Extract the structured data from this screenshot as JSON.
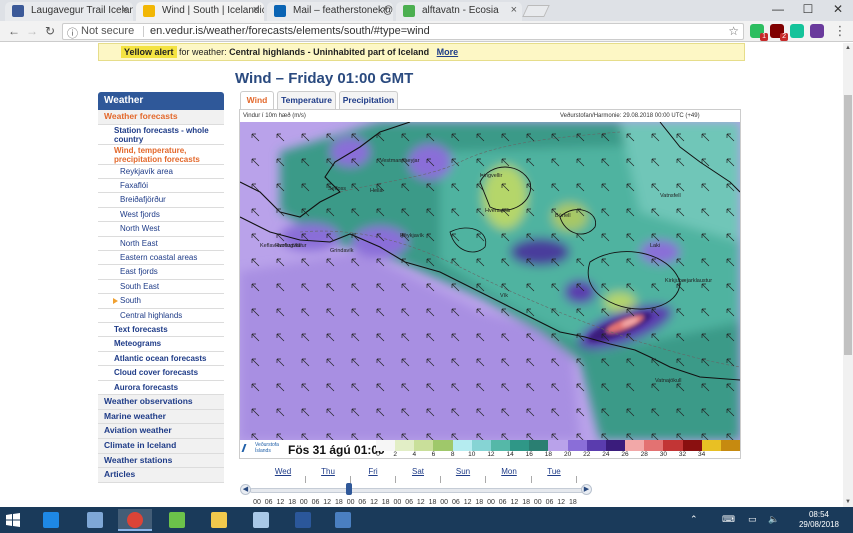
{
  "browser": {
    "tabs": [
      {
        "title": "Laugavegur Trail Iceland",
        "favicon": "facebook-icon",
        "color": "#3b5998",
        "active": false
      },
      {
        "title": "Wind | South | Icelandic M",
        "favicon": "sun-icon",
        "color": "#f2b705",
        "active": true
      },
      {
        "title": "Mail – featherstonek@liv",
        "favicon": "outlook-icon",
        "color": "#0a64b4",
        "active": false
      },
      {
        "title": "alftavatn - Ecosia",
        "favicon": "ecosia-icon",
        "color": "#4caf50",
        "active": false
      }
    ],
    "security": "Not secure",
    "url": "en.vedur.is/weather/forecasts/elements/south/#type=wind",
    "extensions": [
      {
        "name": "evernote-icon",
        "color": "#2dbe60",
        "badge": "1"
      },
      {
        "name": "ublock-icon",
        "color": "#800000",
        "badge": "2"
      },
      {
        "name": "grammarly-icon",
        "color": "#15c39a",
        "badge": ""
      },
      {
        "name": "ghost-icon",
        "color": "#6a3a9c",
        "badge": ""
      }
    ]
  },
  "alert": {
    "tag": "Yellow alert",
    "text": "for weather:",
    "region": "Central highlands - Uninhabited part of Iceland",
    "more": "More"
  },
  "page": {
    "title": "Wind – Friday 01:00 GMT",
    "tabs": [
      "Wind",
      "Temperature",
      "Precipitation"
    ],
    "active_tab": "Wind"
  },
  "sidebar": {
    "heading": "Weather",
    "items": [
      {
        "label": "Weather forecasts",
        "level": 1,
        "active": true
      },
      {
        "label": "Station forecasts - whole country",
        "level": 2,
        "tall": true
      },
      {
        "label": "Wind, temperature, precipitation forecasts",
        "level": 2,
        "active": true,
        "tall": true
      },
      {
        "label": "Reykjavík area",
        "level": 3
      },
      {
        "label": "Faxaflói",
        "level": 3
      },
      {
        "label": "Breiðafjörður",
        "level": 3
      },
      {
        "label": "West fjords",
        "level": 3
      },
      {
        "label": "North West",
        "level": 3
      },
      {
        "label": "North East",
        "level": 3
      },
      {
        "label": "Eastern coastal areas",
        "level": 3
      },
      {
        "label": "East fjords",
        "level": 3
      },
      {
        "label": "South East",
        "level": 3
      },
      {
        "label": "South",
        "level": 3,
        "current": true
      },
      {
        "label": "Central highlands",
        "level": 3
      },
      {
        "label": "Text forecasts",
        "level": 2
      },
      {
        "label": "Meteograms",
        "level": 2
      },
      {
        "label": "Atlantic ocean forecasts",
        "level": 2
      },
      {
        "label": "Cloud cover forecasts",
        "level": 2
      },
      {
        "label": "Aurora forecasts",
        "level": 2
      },
      {
        "label": "Weather observations",
        "level": 1
      },
      {
        "label": "Marine weather",
        "level": 1
      },
      {
        "label": "Aviation weather",
        "level": 1
      },
      {
        "label": "Climate in Iceland",
        "level": 1
      },
      {
        "label": "Weather stations",
        "level": 1
      },
      {
        "label": "Articles",
        "level": 1
      }
    ]
  },
  "map": {
    "header_left": "Vindur í 10m hæð (m/s)",
    "header_right": "Veðurstofan/Harmonie: 29.08.2018 00:00 UTC (+49)",
    "date": "Fös 31 ágú 01:00",
    "logo_lines": [
      "Veðurstofa",
      "Íslands"
    ],
    "place_names": [
      {
        "name": "Vestmannaeyjar",
        "color": "#222"
      },
      {
        "name": "Kirkjubæjarklaustur",
        "color": "#222"
      },
      {
        "name": "Vík",
        "color": "#222"
      },
      {
        "name": "Selfoss",
        "color": "#222"
      },
      {
        "name": "Hella",
        "color": "#222"
      },
      {
        "name": "Hvolsvöllur",
        "color": "#222"
      },
      {
        "name": "Búrfell",
        "color": "#222"
      },
      {
        "name": "Hveravellir",
        "color": "#222"
      },
      {
        "name": "Reykjavík",
        "color": "#222"
      },
      {
        "name": "Keflavíkurflugvöllur",
        "color": "#222"
      },
      {
        "name": "Grindavík",
        "color": "#222"
      },
      {
        "name": "Þingvellir",
        "color": "#222"
      },
      {
        "name": "Vatnsfell",
        "color": "#222"
      },
      {
        "name": "Laki",
        "color": "#222"
      },
      {
        "name": "Vatnajökull",
        "color": "#222"
      }
    ],
    "legend": {
      "labels": [
        "0",
        "2",
        "4",
        "6",
        "8",
        "10",
        "12",
        "14",
        "16",
        "18",
        "20",
        "22",
        "24",
        "26",
        "28",
        "30",
        "32",
        "34"
      ],
      "colors": [
        "#f6f6f6",
        "#e2eec6",
        "#c9df9a",
        "#9fc86a",
        "#b5ecf0",
        "#86d4d4",
        "#55b8a8",
        "#2f9787",
        "#2a7f72",
        "#b9a2ea",
        "#8a6ed8",
        "#5a3cae",
        "#3a1c7c",
        "#f2a8a8",
        "#e37272",
        "#c23535",
        "#8a1010",
        "#e8c024",
        "#c68a10"
      ]
    }
  },
  "timeline": {
    "days": [
      "Wed",
      "Thu",
      "Fri",
      "Sat",
      "Sun",
      "Mon",
      "Tue"
    ],
    "hours": [
      "00",
      "06",
      "12",
      "18",
      "00",
      "06",
      "12",
      "18",
      "00",
      "06",
      "12",
      "18",
      "00",
      "06",
      "12",
      "18",
      "00",
      "06",
      "12",
      "18",
      "00",
      "06",
      "12",
      "18",
      "00",
      "06",
      "12",
      "18"
    ],
    "selected_hour_index": 8
  },
  "taskbar": {
    "apps": [
      {
        "name": "internet-explorer-icon",
        "color": "#1e88e5"
      },
      {
        "name": "notepad-icon",
        "color": "#7fa7d6"
      },
      {
        "name": "chrome-icon",
        "color": "#db4437",
        "active": true
      },
      {
        "name": "weather-app-icon",
        "color": "#6cc24a"
      },
      {
        "name": "file-explorer-icon",
        "color": "#f2c94c"
      },
      {
        "name": "notes-icon",
        "color": "#a8c8e8"
      },
      {
        "name": "word-icon",
        "color": "#2b579a"
      },
      {
        "name": "remote-desktop-icon",
        "color": "#4a7fc1"
      }
    ],
    "time": "08:54",
    "date": "29/08/2018"
  }
}
